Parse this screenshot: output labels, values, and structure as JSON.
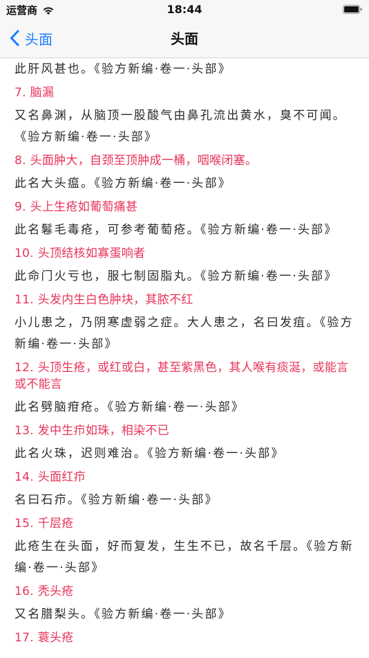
{
  "status_bar": {
    "carrier": "运营商",
    "time": "18:44",
    "wifi_icon": "wifi-icon",
    "battery_icon": "battery-icon"
  },
  "nav": {
    "back_label": "头面",
    "back_icon": "chevron-left-icon",
    "title": "头面",
    "accent_color": "#1a7cff"
  },
  "colors": {
    "entry_title": "#e8345a",
    "entry_body": "#2a2a2a"
  },
  "content": {
    "lead_text": "此肝风甚也。《验方新编·卷一·头部》",
    "entries": [
      {
        "title": "7. 脑漏",
        "body": "又名鼻渊，从脑顶一股酸气由鼻孔流出黄水，臭不可闻。《验方新编·卷一·头部》"
      },
      {
        "title": "8. 头面肿大，自颈至顶肿成一桶，咽喉闭塞。",
        "body": "此名大头瘟。《验方新编·卷一·头部》"
      },
      {
        "title": "9. 头上生疮如葡萄痛甚",
        "body": "此名鬈毛毒疮，可参考葡萄疮。《验方新编·卷一·头部》"
      },
      {
        "title": "10. 头顶结核如寡蛋响者",
        "body": "此命门火亏也，服七制固脂丸。《验方新编·卷一·头部》"
      },
      {
        "title": "11. 头发内生白色肿块，其脓不红",
        "body": "小儿患之，乃阴寒虚弱之症。大人患之，名曰发疽。《验方新编·卷一·头部》"
      },
      {
        "title": "12. 头顶生疮，或红或白，甚至紫黑色，其人喉有痰涎，或能言或不能言",
        "body": "此名劈脑疳疮。《验方新编·卷一·头部》"
      },
      {
        "title": "13. 发中生疖如珠，相染不已",
        "body": "此名火珠，迟则难治。《验方新编·卷一·头部》"
      },
      {
        "title": "14. 头面红疖",
        "body": "名曰石疖。《验方新编·卷一·头部》"
      },
      {
        "title": "15. 千层疮",
        "body": "此疮生在头面，好而复发，生生不已，故名千层。《验方新编·卷一·头部》"
      },
      {
        "title": "16. 秃头疮",
        "body": "又名腊梨头。《验方新编·卷一·头部》"
      },
      {
        "title": "17. 蓑头疮",
        "body": ""
      }
    ]
  }
}
